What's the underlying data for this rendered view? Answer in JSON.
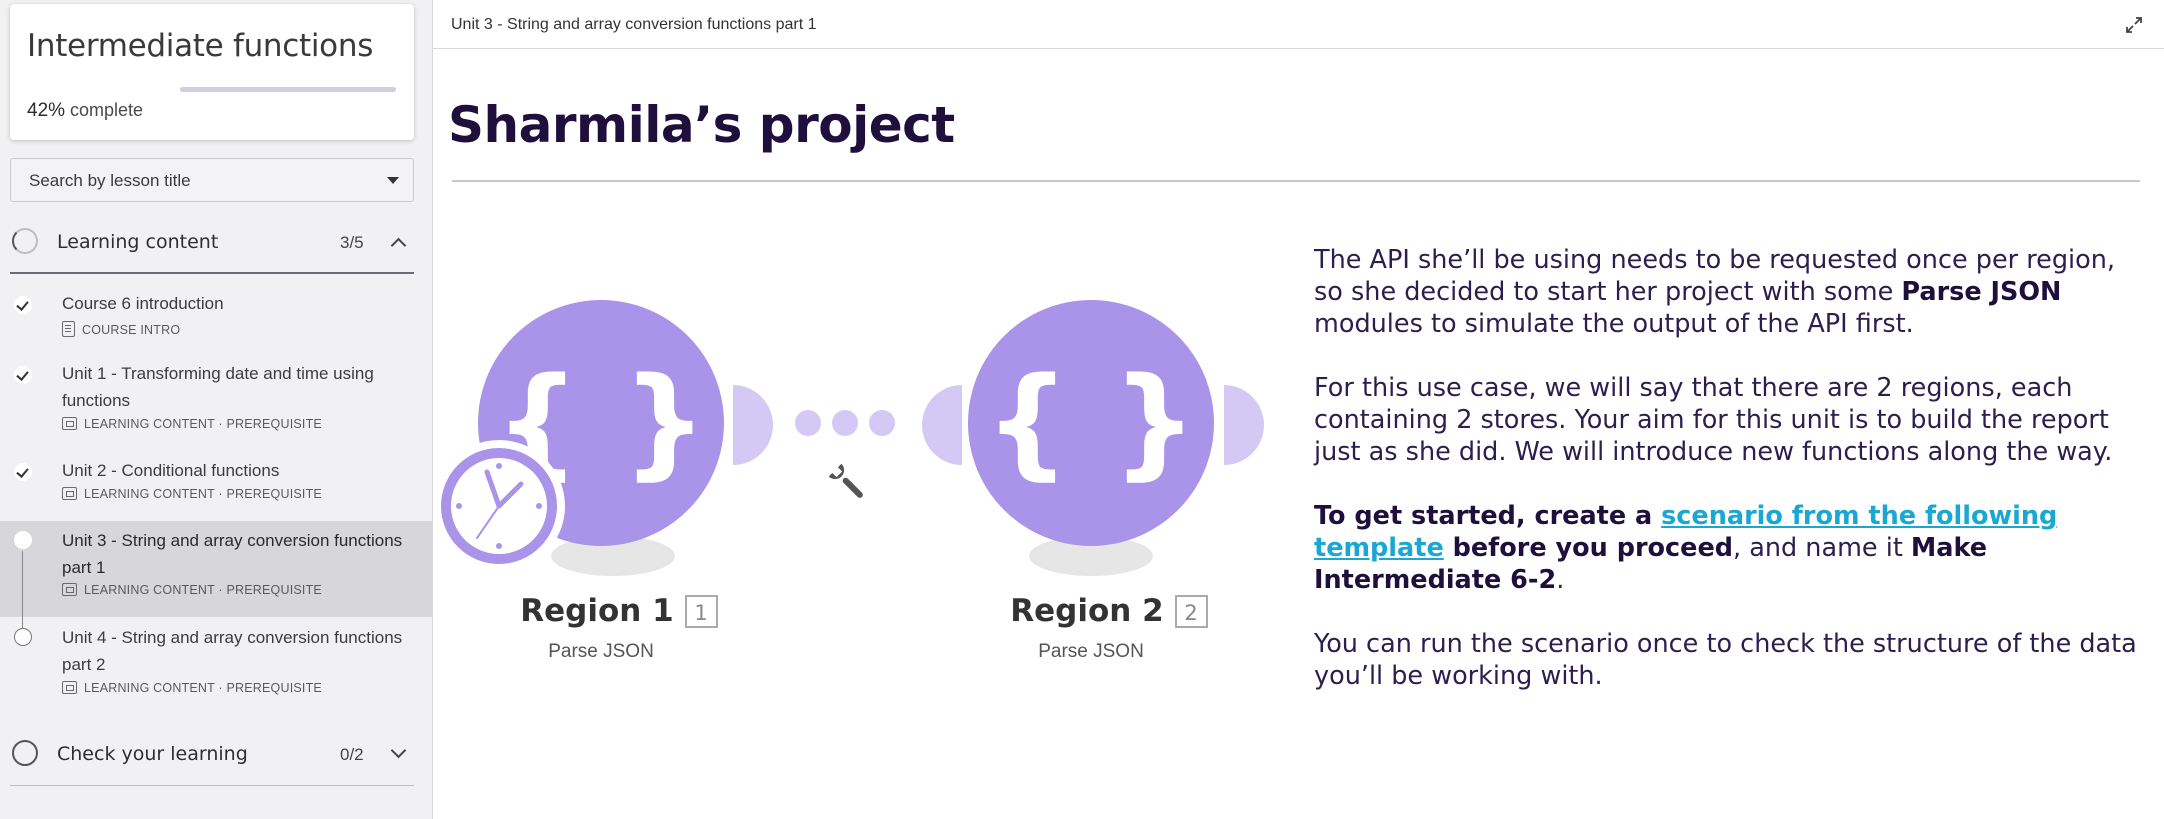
{
  "sidebar": {
    "course_title": "Intermediate functions",
    "progress_percent": "42%",
    "progress_suffix": " complete",
    "progress_fraction": 0.42,
    "search_placeholder": "Search by lesson title",
    "sections": [
      {
        "label": "Learning content",
        "count": "3/5",
        "expanded": true,
        "lessons": [
          {
            "title": "Course 6 introduction",
            "meta": "COURSE INTRO",
            "status": "done"
          },
          {
            "title": "Unit 1 - Transforming date and time using functions",
            "meta": "LEARNING CONTENT · PREREQUISITE",
            "status": "done"
          },
          {
            "title": "Unit 2 - Conditional functions",
            "meta": "LEARNING CONTENT · PREREQUISITE",
            "status": "done"
          },
          {
            "title": "Unit 3 - String and array conversion functions part 1",
            "meta": "LEARNING CONTENT · PREREQUISITE",
            "status": "current"
          },
          {
            "title": "Unit 4 - String and array conversion functions part 2",
            "meta": "LEARNING CONTENT · PREREQUISITE",
            "status": "not-started"
          }
        ]
      },
      {
        "label": "Check your learning",
        "count": "0/2",
        "expanded": false
      }
    ]
  },
  "topbar": {
    "title": "Unit 3 - String and array conversion functions part 1"
  },
  "main": {
    "page_title": "Sharmila’s project",
    "diagram": {
      "module1": {
        "name": "Region 1",
        "badge": "1",
        "subtitle": "Parse JSON"
      },
      "module2": {
        "name": "Region 2",
        "badge": "2",
        "subtitle": "Parse JSON"
      },
      "accent_color": "#a994ea",
      "light_color": "#d3c9f4"
    },
    "paragraphs": {
      "p1_a": "The API she’ll be using needs to be requested once per region, so she decided to start her project with some ",
      "p1_b": "Parse JSON",
      "p1_c": " modules to simulate the output of the API first.",
      "p2": "For this use case, we will say that there are 2 regions, each containing 2 stores. Your aim for this unit is to build the report just as she did. We will introduce new functions along the way.",
      "p3_a": "To get started, create a ",
      "p3_link": "scenario from the following template",
      "p3_b": " before you proceed",
      "p3_c": ", and name it ",
      "p3_d": "Make Intermediate 6-2",
      "p3_e": ".",
      "p4": "You can run the scenario once to check the structure of the data you’ll be working with."
    }
  }
}
